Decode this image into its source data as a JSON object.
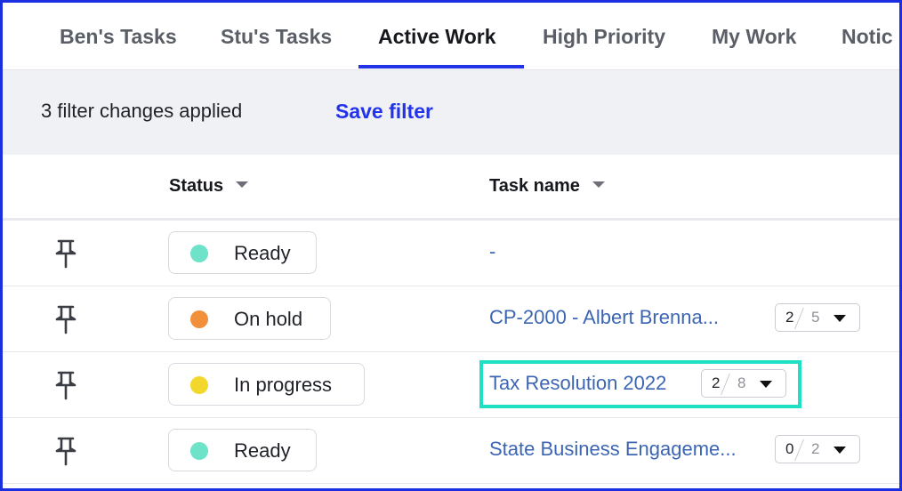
{
  "tabs": [
    {
      "label": "Ben's Tasks",
      "active": false
    },
    {
      "label": "Stu's Tasks",
      "active": false
    },
    {
      "label": "Active Work",
      "active": true
    },
    {
      "label": "High Priority",
      "active": false
    },
    {
      "label": "My Work",
      "active": false
    },
    {
      "label": "Notic",
      "active": false
    }
  ],
  "filter": {
    "summary": "3 filter changes applied",
    "save_label": "Save filter"
  },
  "table": {
    "columns": [
      {
        "label": "Status"
      },
      {
        "label": "Task name"
      }
    ],
    "rows": [
      {
        "status": "Ready",
        "status_color": "#6ee3c9",
        "task": "-",
        "done": "",
        "total": ""
      },
      {
        "status": "On hold",
        "status_color": "#f28f3b",
        "task": "CP-2000 - Albert Brenna...",
        "done": "2",
        "total": "5"
      },
      {
        "status": "In progress",
        "status_color": "#f2d72c",
        "task": "Tax Resolution 2022",
        "done": "2",
        "total": "8"
      },
      {
        "status": "Ready",
        "status_color": "#6ee3c9",
        "task": "State Business Engageme...",
        "done": "0",
        "total": "2"
      }
    ]
  },
  "icons": {
    "pin": "pin-icon",
    "sort": "caret-down-icon",
    "dropdown": "chevron-down-icon"
  },
  "colors": {
    "accent": "#2233e8",
    "link": "#3c66b4",
    "highlight": "#1de0c5"
  }
}
